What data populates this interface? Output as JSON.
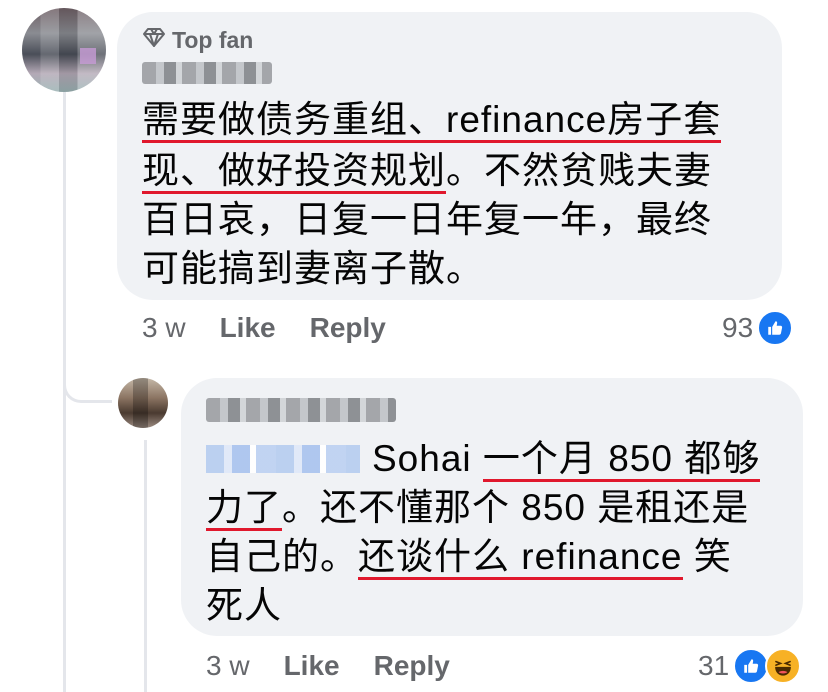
{
  "comment": {
    "badge_label": "Top fan",
    "lines": [
      {
        "underlined": "需要做债务重组、refinance房子套",
        "plain": ""
      },
      {
        "underlined": "现、做好投资规划",
        "plain": "。不然贫贱夫妻"
      },
      {
        "underlined": "",
        "plain": "百日哀，日复一日年复一年，最终"
      },
      {
        "underlined": "",
        "plain": "可能搞到妻离子散。"
      }
    ],
    "time": "3 w",
    "like_label": "Like",
    "reply_label": "Reply",
    "reaction_count": "93",
    "underline_color": "#e0182d"
  },
  "reply": {
    "line1_text": "Sohai ",
    "line1_underlined": "一个月 850 都够",
    "line2_underlined": "力了",
    "line2_plain": "。还不懂那个 850 是租还是",
    "line3_plain": "自己的。",
    "line3_underlined": "还谈什么 refinance",
    "line3_tail": " 笑",
    "line4_plain": "死人",
    "time": "3 w",
    "like_label": "Like",
    "reply_label": "Reply",
    "reaction_count": "31"
  },
  "colors": {
    "bubble": "#f0f2f5",
    "secondary_text": "#65676b",
    "like_blue": "#1877f2",
    "haha_yellow": "#f7b125"
  },
  "icons": [
    "diamond-icon",
    "like-reaction-icon",
    "haha-reaction-icon"
  ]
}
